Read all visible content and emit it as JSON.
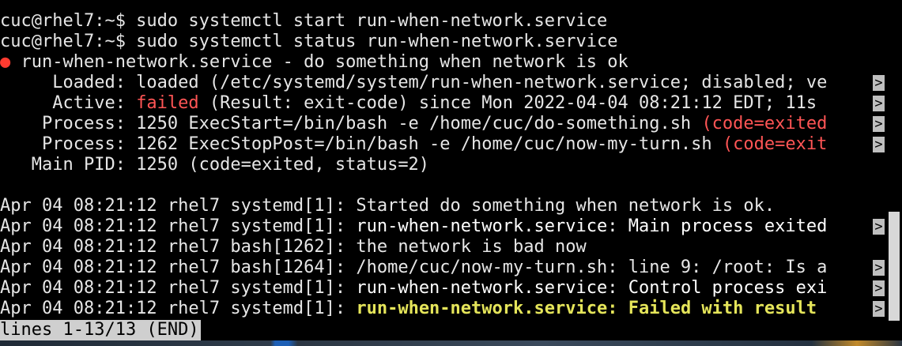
{
  "terminal": {
    "lines": [
      {
        "parts": [
          {
            "text": "cuc@rhel7:~$ sudo systemctl start run-when-network.service",
            "style": "plain"
          }
        ],
        "truncated": false
      },
      {
        "parts": [
          {
            "text": "cuc@rhel7:~$ sudo systemctl status run-when-network.service",
            "style": "plain"
          }
        ],
        "truncated": false
      },
      {
        "parts": [
          {
            "text": "●",
            "style": "dot"
          },
          {
            "text": " run-when-network.service - do something when network is ok",
            "style": "plain"
          }
        ],
        "truncated": false
      },
      {
        "parts": [
          {
            "text": "     Loaded: loaded (/etc/systemd/system/run-when-network.service; disabled; ve",
            "style": "plain"
          }
        ],
        "truncated": true
      },
      {
        "parts": [
          {
            "text": "     Active: ",
            "style": "plain"
          },
          {
            "text": "failed",
            "style": "red"
          },
          {
            "text": " (Result: exit-code) since Mon 2022-04-04 08:21:12 EDT; 11s ",
            "style": "plain"
          }
        ],
        "truncated": true
      },
      {
        "parts": [
          {
            "text": "    Process: 1250 ExecStart=/bin/bash -e /home/cuc/do-something.sh ",
            "style": "plain"
          },
          {
            "text": "(code=exited",
            "style": "red"
          }
        ],
        "truncated": true
      },
      {
        "parts": [
          {
            "text": "    Process: 1262 ExecStopPost=/bin/bash -e /home/cuc/now-my-turn.sh ",
            "style": "plain"
          },
          {
            "text": "(code=exit",
            "style": "red"
          }
        ],
        "truncated": true
      },
      {
        "parts": [
          {
            "text": "   Main PID: 1250 (code=exited, status=2)",
            "style": "plain"
          }
        ],
        "truncated": false
      },
      {
        "parts": [
          {
            "text": "",
            "style": "plain"
          }
        ],
        "truncated": false
      },
      {
        "parts": [
          {
            "text": "Apr 04 08:21:12 rhel7 systemd[1]: Started do something when network is ok.",
            "style": "plain"
          }
        ],
        "truncated": false
      },
      {
        "parts": [
          {
            "text": "Apr 04 08:21:12 rhel7 systemd[1]: ",
            "style": "plain"
          },
          {
            "text": "run-when-network.service: Main process exited",
            "style": "white"
          }
        ],
        "truncated": true
      },
      {
        "parts": [
          {
            "text": "Apr 04 08:21:12 rhel7 bash[1262]: the network is bad now",
            "style": "plain"
          }
        ],
        "truncated": false
      },
      {
        "parts": [
          {
            "text": "Apr 04 08:21:12 rhel7 bash[1264]: /home/cuc/now-my-turn.sh: line 9: /root: Is a",
            "style": "plain"
          }
        ],
        "truncated": true
      },
      {
        "parts": [
          {
            "text": "Apr 04 08:21:12 rhel7 systemd[1]: ",
            "style": "plain"
          },
          {
            "text": "run-when-network.service: Control process exi",
            "style": "white"
          }
        ],
        "truncated": true
      },
      {
        "parts": [
          {
            "text": "Apr 04 08:21:12 rhel7 systemd[1]: ",
            "style": "plain"
          },
          {
            "text": "run-when-network.service: Failed with result ",
            "style": "yellow"
          }
        ],
        "truncated": true
      }
    ],
    "truncation_marker": ">",
    "pager_status": "lines 1-13/13 (END)"
  },
  "colors": {
    "background": "#000000",
    "text": "#e6e6e6",
    "error_red": "#ff5555",
    "warning_yellow": "#e5e55a",
    "status_bar": "#cfcfcf"
  },
  "icons": {
    "status_indicator": "failed-dot-icon"
  }
}
